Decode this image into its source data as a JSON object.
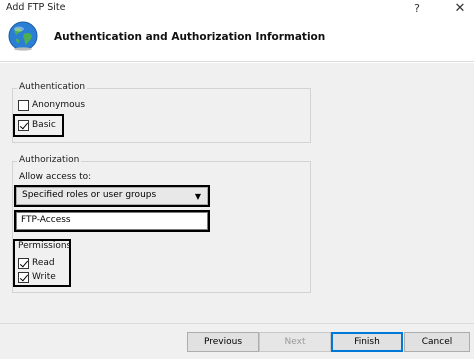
{
  "window": {
    "title": "Add FTP Site",
    "help_glyph": "?",
    "close_glyph": "✕"
  },
  "header": {
    "title": "Authentication and Authorization Information",
    "icon": "globe-icon"
  },
  "authentication": {
    "legend": "Authentication",
    "anonymous": {
      "label": "Anonymous",
      "checked": false
    },
    "basic": {
      "label": "Basic",
      "checked": true
    }
  },
  "authorization": {
    "legend": "Authorization",
    "allow_access_label": "Allow access to:",
    "allow_access_value": "Specified roles or user groups",
    "roles_value": "FTP-Access"
  },
  "permissions": {
    "legend": "Permissions",
    "read": {
      "label": "Read",
      "checked": true
    },
    "write": {
      "label": "Write",
      "checked": true
    }
  },
  "buttons": {
    "previous": "Previous",
    "next": "Next",
    "finish": "Finish",
    "cancel": "Cancel"
  },
  "colors": {
    "accent": "#0078d7",
    "content_bg": "#f0f0f0"
  }
}
